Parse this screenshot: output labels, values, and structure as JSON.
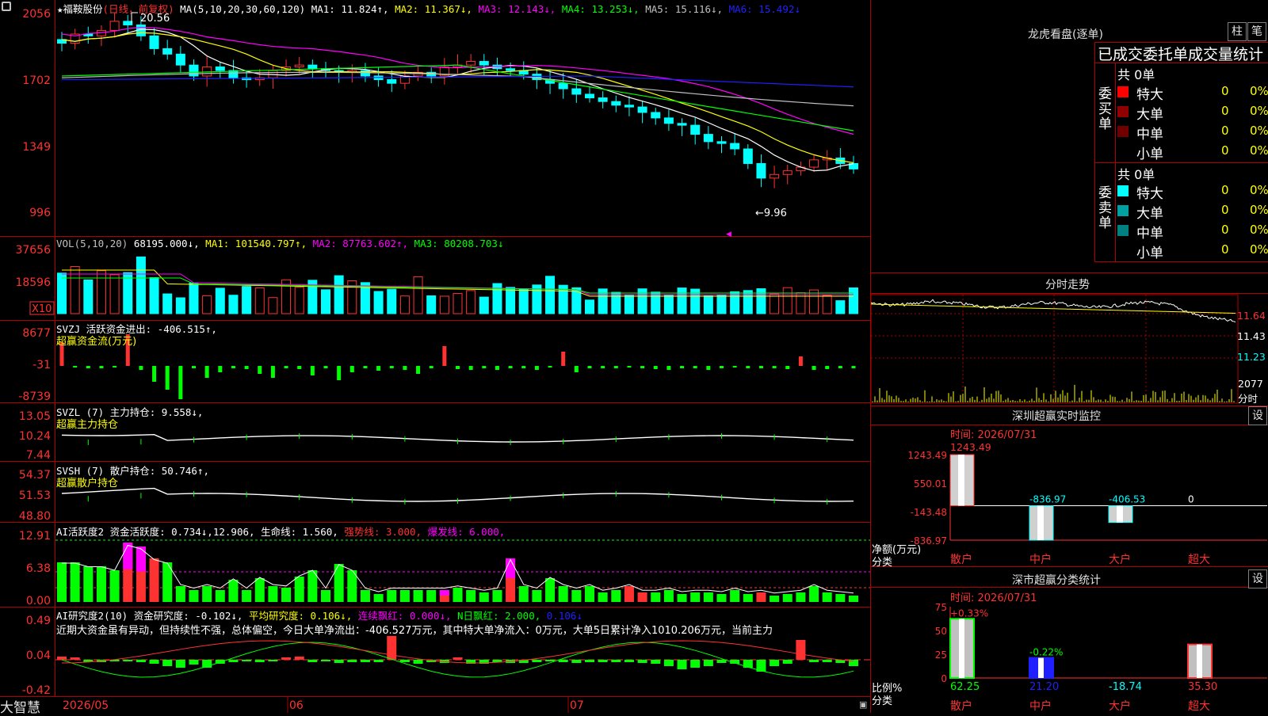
{
  "colors": {
    "up": "#ff3232",
    "down": "#00ffff",
    "grid": "#b00000",
    "white": "#ffffff",
    "yellow": "#ffff00",
    "magenta": "#ff00ff",
    "green": "#00ff00",
    "blue": "#0000ff",
    "gray": "#c0c0c0",
    "label": "#ff3232"
  },
  "logo": "大智慧",
  "main_header": {
    "star": "★",
    "stock": "福鞍股份",
    "period": "(日线，前复权)",
    "ma_label": "MA(5,10,20,30,60,120)",
    "ma1": "MA1: 11.824↑,",
    "ma2": "MA2: 11.367↓,",
    "ma3": "MA3: 12.143↓,",
    "ma4": "MA4: 13.253↓,",
    "ma5": "MA5: 15.116↓,",
    "ma6": "MA6: 15.492↓"
  },
  "price_axis": [
    "2056",
    "1702",
    "1349",
    "996"
  ],
  "price_marks": {
    "high": "20.56",
    "low": "←9.96"
  },
  "vol_header": {
    "label": "VOL(5,10,20)",
    "val": "68195.000↓,",
    "ma1": "MA1: 101540.797↑,",
    "ma2": "MA2: 87763.602↑,",
    "ma3": "MA3: 80208.703↓"
  },
  "vol_axis": [
    "37656",
    "18596"
  ],
  "vol_unit": "X10",
  "svzj": {
    "line1": "SVZJ  活跃资金进出: -406.515↑,",
    "line2": "超赢资金流(万元)",
    "axis": [
      "8677",
      "-31",
      "-8739"
    ]
  },
  "svzl": {
    "line1": "SVZL (7) 主力持仓: 9.558↓,",
    "line2": "超赢主力持仓",
    "axis": [
      "13.05",
      "10.24",
      "7.44"
    ]
  },
  "svsh": {
    "line1": "SVSH (7) 散户持仓: 50.746↑,",
    "line2": "超赢散户持仓",
    "axis": [
      "54.37",
      "51.53",
      "48.80"
    ]
  },
  "ai1": {
    "name": "AI活跃度2 资金活跃度: 0.734↓,",
    "v2": "12.906,",
    "v3": "生命线: 1.560,",
    "v4": "强势线: 3.000,",
    "v5": "爆发线: 6.000,",
    "axis": [
      "12.91",
      "6.38",
      "0.00"
    ]
  },
  "ai2": {
    "name": "AI研究度2(10) 资金研究度: -0.102↓,",
    "v2": "平均研究度: 0.106↓,",
    "v3": "连续飘红: 0.000↓,",
    "v4": "N日飘红: 2.000,",
    "v5": "0.106↓",
    "note": "近期大资金虽有异动，但持续性不强，总体偏空，今日大单净流出：-406.527万元，其中特大单净流入：0万元，大单5日累计净入1010.206万元，当前主力",
    "axis": [
      "0.49",
      "0.04",
      "-0.42"
    ]
  },
  "dates": [
    "2026/05",
    "06",
    "07"
  ],
  "lhb": {
    "title": "龙虎看盘(逐单)",
    "btn1": "柱",
    "btn2": "笔",
    "subtitle": "已成交委托单成交量统计",
    "buy_label": "委买单",
    "sell_label": "委卖单",
    "buy_total": "共 0单",
    "sell_total": "共 0单",
    "buy_rows": [
      {
        "name": "特大",
        "v": "0",
        "p": "0%",
        "c": "#ff0000"
      },
      {
        "name": "大单",
        "v": "0",
        "p": "0%",
        "c": "#900000"
      },
      {
        "name": "中单",
        "v": "0",
        "p": "0%",
        "c": "#700000"
      },
      {
        "name": "小单",
        "v": "0",
        "p": "0%",
        "c": ""
      }
    ],
    "sell_rows": [
      {
        "name": "特大",
        "v": "0",
        "p": "0%",
        "c": "#00ffff"
      },
      {
        "name": "大单",
        "v": "0",
        "p": "0%",
        "c": "#00a0a0"
      },
      {
        "name": "中单",
        "v": "0",
        "p": "0%",
        "c": "#008080"
      },
      {
        "name": "小单",
        "v": "0",
        "p": "0%",
        "c": ""
      }
    ]
  },
  "fenshi": {
    "title": "分时走势",
    "axis": [
      "11.64",
      "11.43",
      "11.23"
    ],
    "vol": "2077",
    "vol_unit": "分时"
  },
  "monitor": {
    "title": "深圳超赢实时监控",
    "btn": "设",
    "time": "时间: 2026/07/31",
    "top": "1243.49",
    "axis": [
      "1243.49",
      "550.01",
      "-143.48",
      "-836.97"
    ],
    "ylabel": "净额(万元)",
    "xlabel": "分类",
    "cats": [
      "散户",
      "中户",
      "大户",
      "超大"
    ],
    "values": [
      1243.49,
      -836.97,
      -406.53,
      0
    ],
    "labels": [
      "",
      "-836.97",
      "-406.53",
      "0"
    ]
  },
  "classify": {
    "title": "深市超赢分类统计",
    "btn": "设",
    "time": "时间: 2026/07/31",
    "axis": [
      "75",
      "50",
      "25",
      "0"
    ],
    "ylabel": "比例%",
    "xlabel": "分类",
    "cats": [
      "散户",
      "中户",
      "大户",
      "超大"
    ],
    "pct": [
      62.25,
      21.2,
      -18.74,
      35.3
    ],
    "bottom": [
      "62.25",
      "21.20",
      "-18.74",
      "35.30"
    ],
    "toplabels": [
      "+0.33%",
      "-0.22%",
      "",
      ""
    ]
  }
}
